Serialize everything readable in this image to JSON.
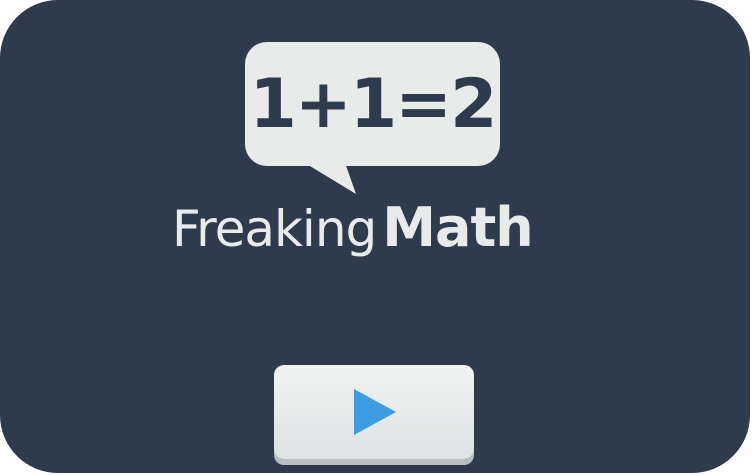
{
  "logo": {
    "equation": "1+1=2",
    "title_light": "Freaking",
    "title_bold": "Math"
  },
  "play_button": {
    "icon": "play-icon"
  },
  "colors": {
    "background": "#2e3b4d",
    "bubble": "#e9ebeb",
    "text_light": "#e9ebeb",
    "play_icon": "#3d9de3",
    "button": "#eceeef"
  }
}
